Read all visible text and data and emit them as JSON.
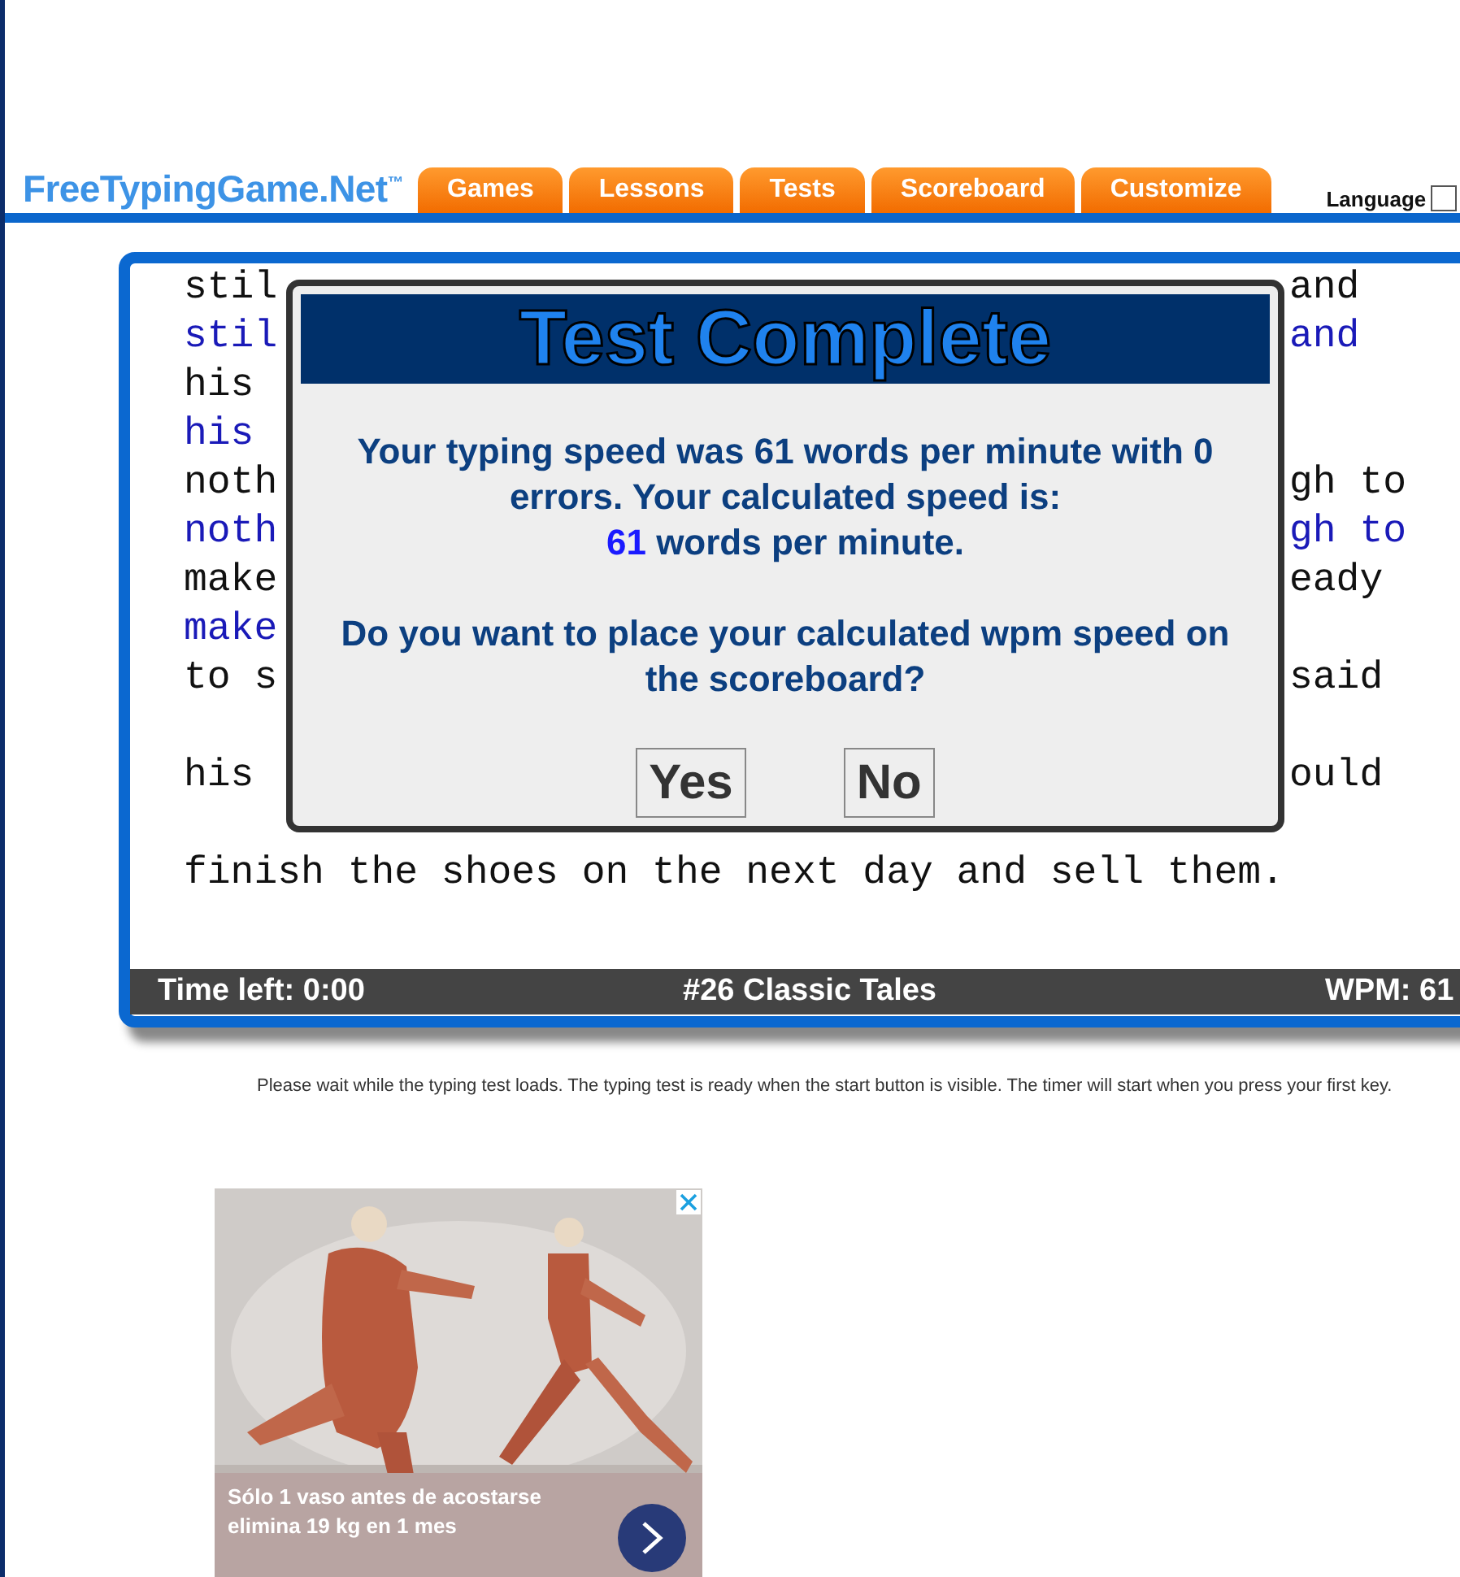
{
  "header": {
    "logo": "FreeTypingGame.Net$^{™}$",
    "tabs": [
      {
        "label": "Games"
      },
      {
        "label": "Lessons"
      },
      {
        "label": "Tests"
      },
      {
        "label": "Scoreboard"
      },
      {
        "label": "Customize"
      }
    ],
    "language_label": "Language"
  },
  "typing_lines": [
    {
      "kind": "typed",
      "left": "stil",
      "right": "and"
    },
    {
      "kind": "echo",
      "left": "stil",
      "right": "and"
    },
    {
      "kind": "typed",
      "left": "his"
    },
    {
      "kind": "echo",
      "left": "his"
    },
    {
      "kind": "typed",
      "left": "noth",
      "right": "gh to"
    },
    {
      "kind": "echo",
      "left": "noth",
      "right": "gh to"
    },
    {
      "kind": "typed",
      "left": "make",
      "right": "eady"
    },
    {
      "kind": "echo",
      "left": "make"
    },
    {
      "kind": "typed",
      "left": "to s",
      "right": "said"
    },
    {
      "kind": "blank"
    },
    {
      "kind": "typed",
      "left": "his",
      "right": "ould"
    },
    {
      "kind": "blank"
    },
    {
      "kind": "typed",
      "left": "finish the shoes on the next day and sell them."
    }
  ],
  "status_bar": {
    "time_left": "Time left: 0:00",
    "title": "#26 Classic Tales",
    "wpm": "WPM: 61"
  },
  "dialog": {
    "title": "Test Complete",
    "message": "Your typing speed was 61 words per minute with 0 errors. Your calculated speed is:",
    "speed": "61",
    "speed_unit": "words per minute.",
    "question": "Do you want to place your calculated wpm speed on the scoreboard?",
    "buttons": [
      "Yes",
      "No"
    ]
  },
  "notice": "Please wait while the typing test loads. The typing test is ready when the start button is visible. The timer will start when you press your first key.",
  "ad": {
    "kind": "picture",
    "caption": "Sólo 1 vaso antes de acostarse elimina 19 kg en 1 mes"
  }
}
